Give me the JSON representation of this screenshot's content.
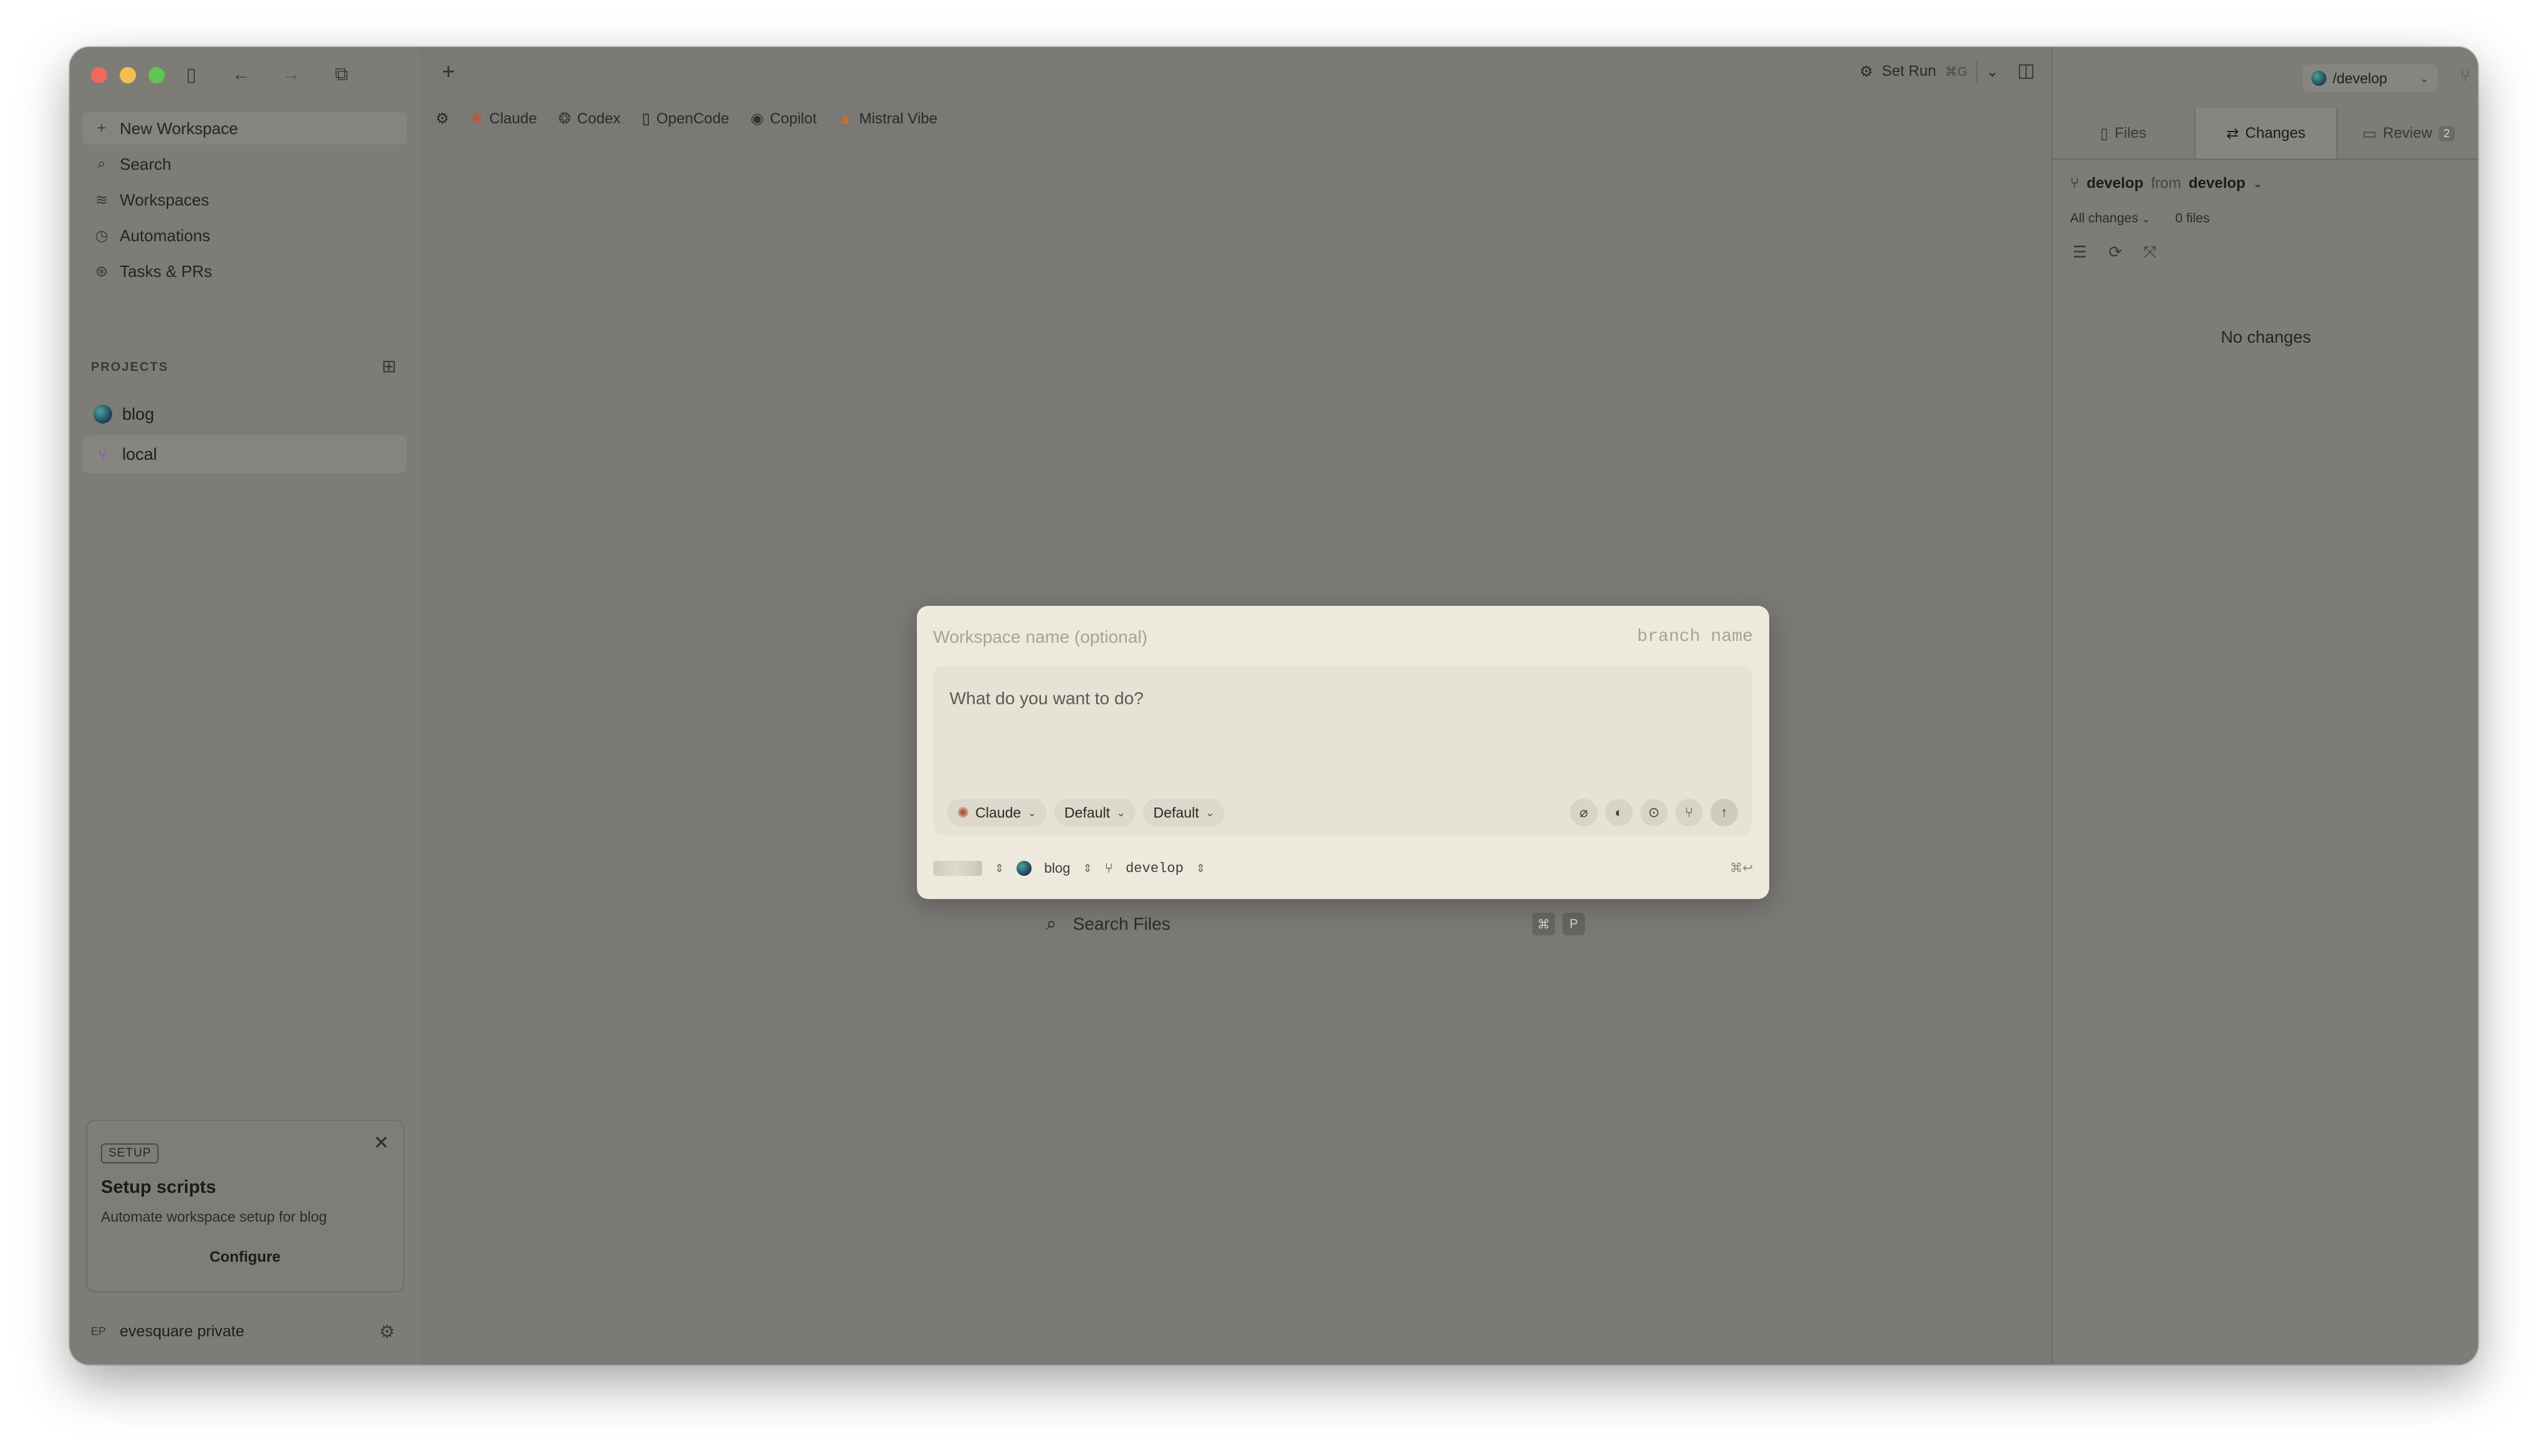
{
  "sidebar": {
    "nav": [
      {
        "icon": "plus-icon",
        "label": "New Workspace"
      },
      {
        "icon": "search-icon",
        "label": "Search"
      },
      {
        "icon": "layers-icon",
        "label": "Workspaces"
      },
      {
        "icon": "clock-icon",
        "label": "Automations"
      },
      {
        "icon": "tasks-icon",
        "label": "Tasks & PRs"
      }
    ],
    "projects_label": "PROJECTS",
    "projects": [
      {
        "name": "blog",
        "icon": "globe-icon"
      },
      {
        "name": "local",
        "icon": "branch-icon"
      }
    ],
    "setup": {
      "badge": "SETUP",
      "title": "Setup scripts",
      "description": "Automate workspace setup for blog",
      "action": "Configure"
    },
    "account": {
      "initials": "EP",
      "name": "evesquare private"
    }
  },
  "main": {
    "set_run": {
      "label": "Set Run",
      "shortcut": "⌘G"
    },
    "agents": [
      {
        "icon": "claude-icon",
        "label": "Claude"
      },
      {
        "icon": "codex-icon",
        "label": "Codex"
      },
      {
        "icon": "opencode-icon",
        "label": "OpenCode"
      },
      {
        "icon": "copilot-icon",
        "label": "Copilot"
      },
      {
        "icon": "mistral-icon",
        "label": "Mistral Vibe"
      }
    ],
    "search_files": {
      "placeholder": "Search Files",
      "keys": [
        "⌘",
        "P"
      ]
    }
  },
  "dialog": {
    "workspace_name_placeholder": "Workspace name (optional)",
    "branch_name_placeholder": "branch name",
    "prompt_placeholder": "What do you want to do?",
    "agent": "Claude",
    "mode_1": "Default",
    "mode_2": "Default",
    "project": "blog",
    "branch": "develop",
    "submit_hint": "⌘↩"
  },
  "right_panel": {
    "branch_selector": "/develop",
    "tabs": [
      {
        "label": "Files",
        "icon": "file-icon"
      },
      {
        "label": "Changes",
        "icon": "diff-icon"
      },
      {
        "label": "Review",
        "icon": "comment-icon",
        "badge": "2"
      }
    ],
    "branch": "develop",
    "from_label": "from",
    "base_branch": "develop",
    "filter": "All changes",
    "file_count": "0 files",
    "empty_message": "No changes"
  }
}
